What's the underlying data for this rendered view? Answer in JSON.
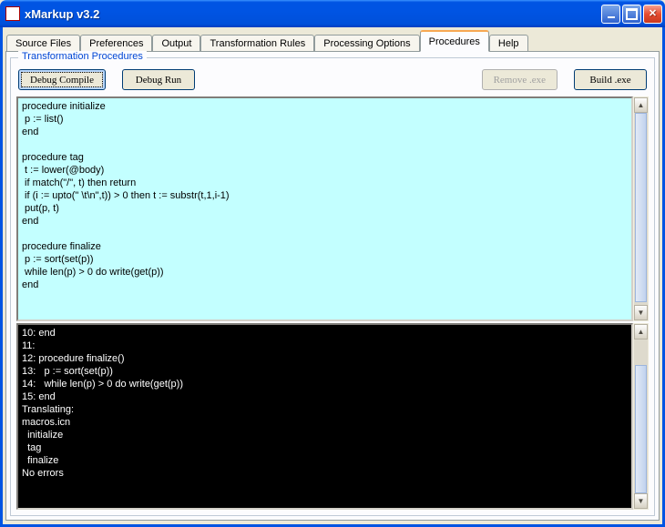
{
  "window": {
    "title": "xMarkup v3.2"
  },
  "tabs": [
    {
      "label": "Source Files"
    },
    {
      "label": "Preferences"
    },
    {
      "label": "Output"
    },
    {
      "label": "Transformation Rules"
    },
    {
      "label": "Processing Options"
    },
    {
      "label": "Procedures"
    },
    {
      "label": "Help"
    }
  ],
  "active_tab": "Procedures",
  "group": {
    "title": "Transformation Procedures"
  },
  "buttons": {
    "debug_compile": "Debug Compile",
    "debug_run": "Debug Run",
    "remove_exe": "Remove .exe",
    "build_exe": "Build .exe"
  },
  "editor_text": "procedure initialize\n p := list()\nend\n\nprocedure tag\n t := lower(@body)\n if match(\"/\", t) then return\n if (i := upto(\" \\t\\n\",t)) > 0 then t := substr(t,1,i-1)\n put(p, t)\nend\n\nprocedure finalize\n p := sort(set(p))\n while len(p) > 0 do write(get(p))\nend",
  "console_text": "10: end\n11:\n12: procedure finalize()\n13:   p := sort(set(p))\n14:   while len(p) > 0 do write(get(p))\n15: end\nTranslating:\nmacros.icn\n  initialize\n  tag\n  finalize\nNo errors"
}
